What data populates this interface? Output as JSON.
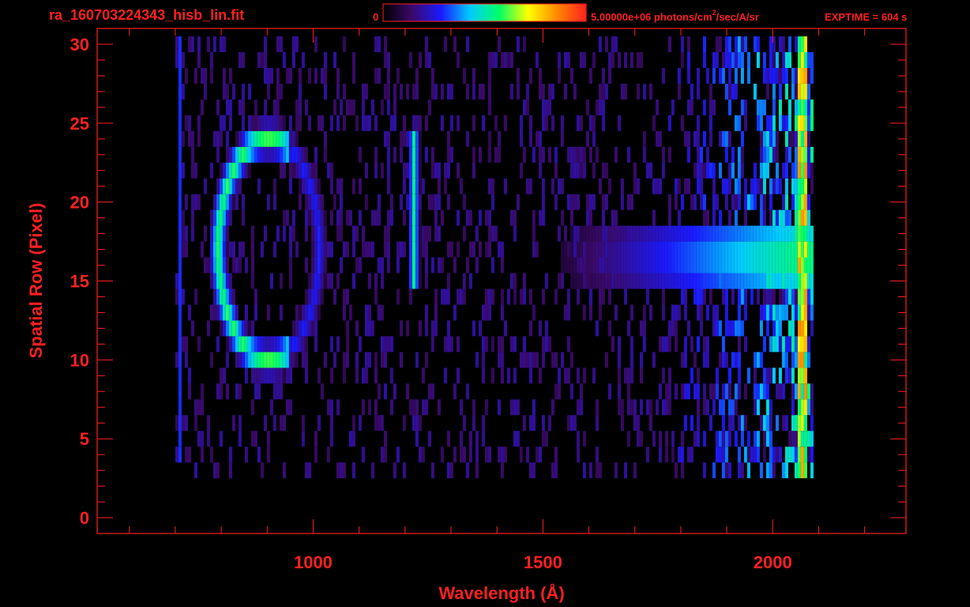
{
  "header": {
    "filename": "ra_160703224343_hisb_lin.fit",
    "colorbar_min": "0",
    "colorbar_max_value": "5.00000e+06 photons/cm",
    "colorbar_max_sup": "2",
    "colorbar_max_rest": "/sec/A/sr",
    "exptime": "EXPTIME = 604 s"
  },
  "chart_data": {
    "type": "heatmap",
    "title": "ra_160703224343_hisb_lin.fit",
    "xlabel": "Wavelength (Å)",
    "ylabel": "Spatial Row (Pixel)",
    "xlim": [
      530,
      2290
    ],
    "ylim": [
      -1,
      31
    ],
    "x_ticks": [
      1000,
      1500,
      2000
    ],
    "x_tick_labels": [
      "1000",
      "1500",
      "2000"
    ],
    "y_ticks": [
      0,
      5,
      10,
      15,
      20,
      25,
      30
    ],
    "y_tick_labels": [
      "0",
      "5",
      "10",
      "15",
      "20",
      "25",
      "30"
    ],
    "colorbar": {
      "min_label": "0",
      "max_value": 5000000,
      "units": "photons/cm^2/sec/A/sr",
      "colors": [
        "#000000",
        "#3a0a6a",
        "#1a1aff",
        "#00ccff",
        "#00ff66",
        "#ffff00",
        "#ff8800",
        "#ff2020"
      ]
    },
    "data_extent": {
      "x": [
        700,
        2085
      ],
      "rows": [
        3,
        30
      ]
    },
    "features": [
      {
        "name": "sky-continuum",
        "rows": [
          15,
          18
        ],
        "x": [
          1600,
          2060
        ],
        "peak_intensity": 0.55
      },
      {
        "name": "ring-emission",
        "center_x": 900,
        "center_row": 17,
        "radius_x": 110,
        "radius_row": 7,
        "peak_intensity": 0.6
      },
      {
        "name": "line-1216",
        "x": 1216,
        "rows": [
          15,
          24
        ],
        "peak_intensity": 0.55
      },
      {
        "name": "edge-2060",
        "x": 2062,
        "rows": [
          0,
          30
        ],
        "peak_intensity": 0.85
      },
      {
        "name": "streak-700",
        "x": 706,
        "rows": [
          4,
          30
        ],
        "peak_intensity": 0.3
      }
    ],
    "grid": false,
    "legend": "colorbar top"
  }
}
